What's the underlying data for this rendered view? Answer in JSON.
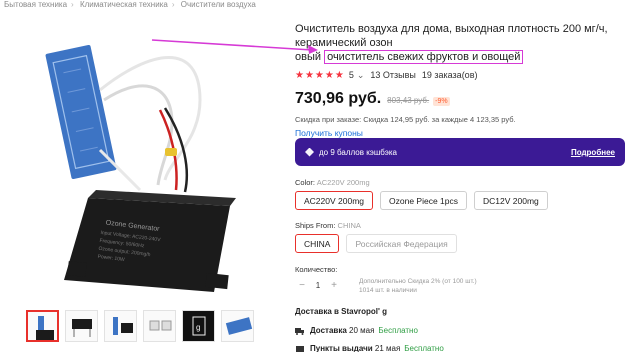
{
  "breadcrumbs": [
    "Бытовая техника",
    "Климатическая техника",
    "Очистители воздуха"
  ],
  "title_line1": "Очиститель воздуха для дома, выходная плотность 200 мг/ч, керамический озон",
  "title_line2_prefix": "овый",
  "title_line2_highlight": "очиститель свежих фруктов и овощей",
  "rating": {
    "stars": "★★★★★",
    "value": "5",
    "reviews": "13 Отзывы",
    "orders": "19 заказа(ов)"
  },
  "price": {
    "current": "730,96 руб.",
    "old": "803,43 руб.",
    "discount": "-9%"
  },
  "bulk_discount": "Скидка при заказе: Скидка 124,95 руб. за каждые 4 123,35 руб.",
  "coupons_link": "Получить купоны",
  "cashback": {
    "text": "до 9 баллов кэшбэка",
    "more": "Подробнее"
  },
  "color": {
    "label": "Color:",
    "selected": "AC220V 200mg",
    "options": [
      "AC220V 200mg",
      "Ozone Piece 1pcs",
      "DC12V 200mg"
    ]
  },
  "ships_from": {
    "label": "Ships From:",
    "selected": "CHINA",
    "options": [
      "CHINA",
      "Российская Федерация"
    ]
  },
  "quantity": {
    "label": "Количество:",
    "minus": "−",
    "value": "1",
    "plus": "+",
    "info_line1": "Дополнительно Скидка 2% (от 100 шт.)",
    "info_line2": "1014 шт. в наличии"
  },
  "delivery": {
    "to": "Доставка в Stavropol' g",
    "line1_label": "Доставка",
    "line1_date": "20 мая",
    "line1_free": "Бесплатно",
    "line2_label": "Пункты выдачи",
    "line2_date": "21 мая",
    "line2_free": "Бесплатно"
  },
  "annotation_color": "#d63ad6",
  "accent_colors": {
    "selected_border": "#e8302b",
    "cashback_bg": "#3b1a95",
    "stars": "#f5333f"
  },
  "icons": [
    "chevron-down-icon",
    "cashback-diamond-icon",
    "truck-icon",
    "pickup-icon"
  ]
}
